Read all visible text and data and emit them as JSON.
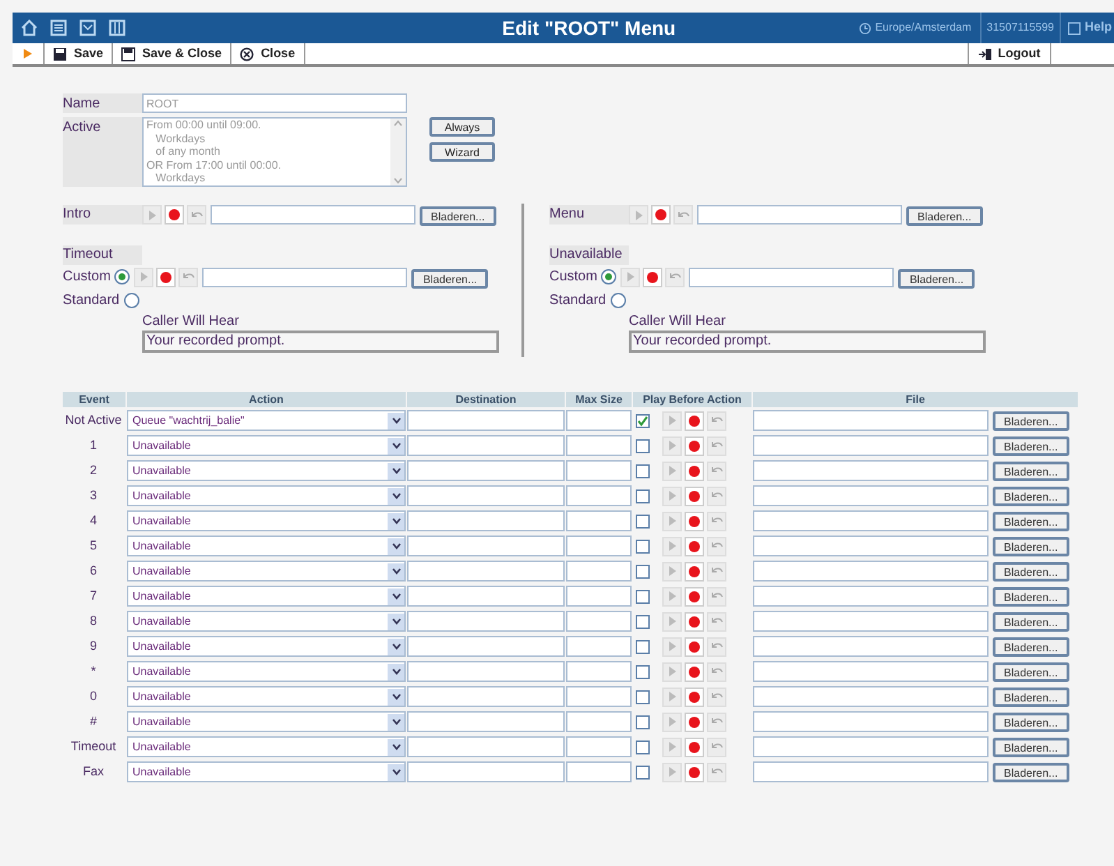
{
  "header": {
    "title": "Edit \"ROOT\" Menu",
    "timezone": "Europe/Amsterdam",
    "phone": "31507115599",
    "help": "Help"
  },
  "toolbar": {
    "buttons": [
      {
        "kind": "save",
        "label": "Save"
      },
      {
        "kind": "saveclose",
        "label": "Save & Close"
      },
      {
        "kind": "close",
        "label": "Close"
      }
    ],
    "logout": "Logout"
  },
  "form": {
    "name": {
      "label": "Name",
      "value": "ROOT"
    },
    "active": {
      "label": "Active",
      "value": "From 00:00 until 09:00.\n   Workdays\n   of any month\nOR From 17:00 until 00:00.\n   Workdays"
    },
    "buttons": [
      "Always",
      "Wizard"
    ]
  },
  "prompts": [
    {
      "label": "Intro",
      "browse": "Bladeren...",
      "section": "Timeout",
      "options": [
        {
          "label": "Custom",
          "selected": true
        },
        {
          "label": "Standard",
          "selected": false
        }
      ],
      "browse2": "Bladeren...",
      "caller_label": "Caller Will Hear",
      "caller_value": "Your recorded prompt."
    },
    {
      "label": "Menu",
      "browse": "Bladeren...",
      "section": "Unavailable",
      "options": [
        {
          "label": "Custom",
          "selected": true
        },
        {
          "label": "Standard",
          "selected": false
        }
      ],
      "browse2": "Bladeren...",
      "caller_label": "Caller Will Hear",
      "caller_value": "Your recorded prompt."
    }
  ],
  "table": {
    "columns": [
      "Event",
      "Action",
      "Destination",
      "Max Size",
      "Play Before Action",
      "File"
    ],
    "rows": [
      {
        "event": "Not Active",
        "action": "Queue \"wachtrij_balie\"",
        "play": true,
        "browse": "Bladeren..."
      },
      {
        "event": "1",
        "action": "Unavailable",
        "play": false,
        "browse": "Bladeren..."
      },
      {
        "event": "2",
        "action": "Unavailable",
        "play": false,
        "browse": "Bladeren..."
      },
      {
        "event": "3",
        "action": "Unavailable",
        "play": false,
        "browse": "Bladeren..."
      },
      {
        "event": "4",
        "action": "Unavailable",
        "play": false,
        "browse": "Bladeren..."
      },
      {
        "event": "5",
        "action": "Unavailable",
        "play": false,
        "browse": "Bladeren..."
      },
      {
        "event": "6",
        "action": "Unavailable",
        "play": false,
        "browse": "Bladeren..."
      },
      {
        "event": "7",
        "action": "Unavailable",
        "play": false,
        "browse": "Bladeren..."
      },
      {
        "event": "8",
        "action": "Unavailable",
        "play": false,
        "browse": "Bladeren..."
      },
      {
        "event": "9",
        "action": "Unavailable",
        "play": false,
        "browse": "Bladeren..."
      },
      {
        "event": "*",
        "action": "Unavailable",
        "play": false,
        "browse": "Bladeren..."
      },
      {
        "event": "0",
        "action": "Unavailable",
        "play": false,
        "browse": "Bladeren..."
      },
      {
        "event": "#",
        "action": "Unavailable",
        "play": false,
        "browse": "Bladeren..."
      },
      {
        "event": "Timeout",
        "action": "Unavailable",
        "play": false,
        "browse": "Bladeren..."
      },
      {
        "event": "Fax",
        "action": "Unavailable",
        "play": false,
        "browse": "Bladeren..."
      }
    ]
  }
}
